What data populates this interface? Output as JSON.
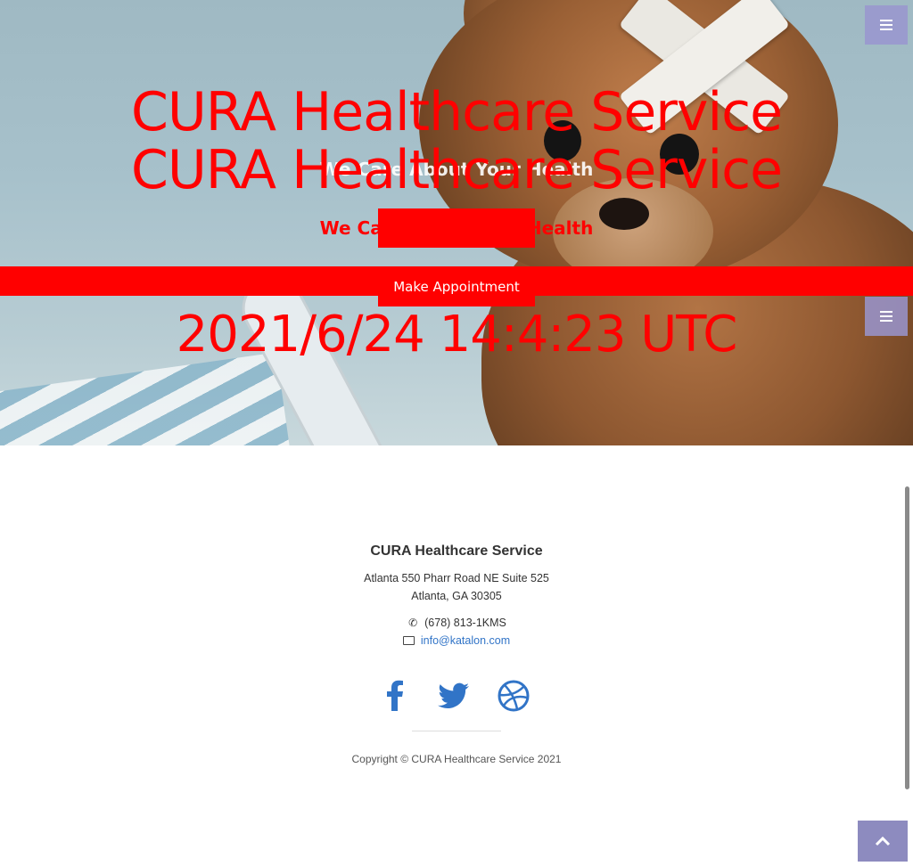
{
  "hero": {
    "title": "CURA Healthcare Service",
    "title_duplicate": "CURA Healthcare Service",
    "subtitle": "We Care About Your Health",
    "subtitle_ghost": "We Care About Your Health",
    "appointment_button": "Make Appointment",
    "clock": "2021/6/24 14:4:23 UTC"
  },
  "menu": {
    "icon": "bars-icon"
  },
  "footer": {
    "title": "CURA Healthcare Service",
    "address_line1": "Atlanta 550 Pharr Road NE Suite 525",
    "address_line2": "Atlanta, GA 30305",
    "phone": "(678) 813-1KMS",
    "email": "info@katalon.com",
    "social": [
      "facebook-icon",
      "twitter-icon",
      "dribbble-icon"
    ],
    "copyright": "Copyright © CURA Healthcare Service 2021"
  },
  "colors": {
    "overlay_red": "#ff0000",
    "link_blue": "#3174c7",
    "menu_purple": "#9995cf"
  }
}
